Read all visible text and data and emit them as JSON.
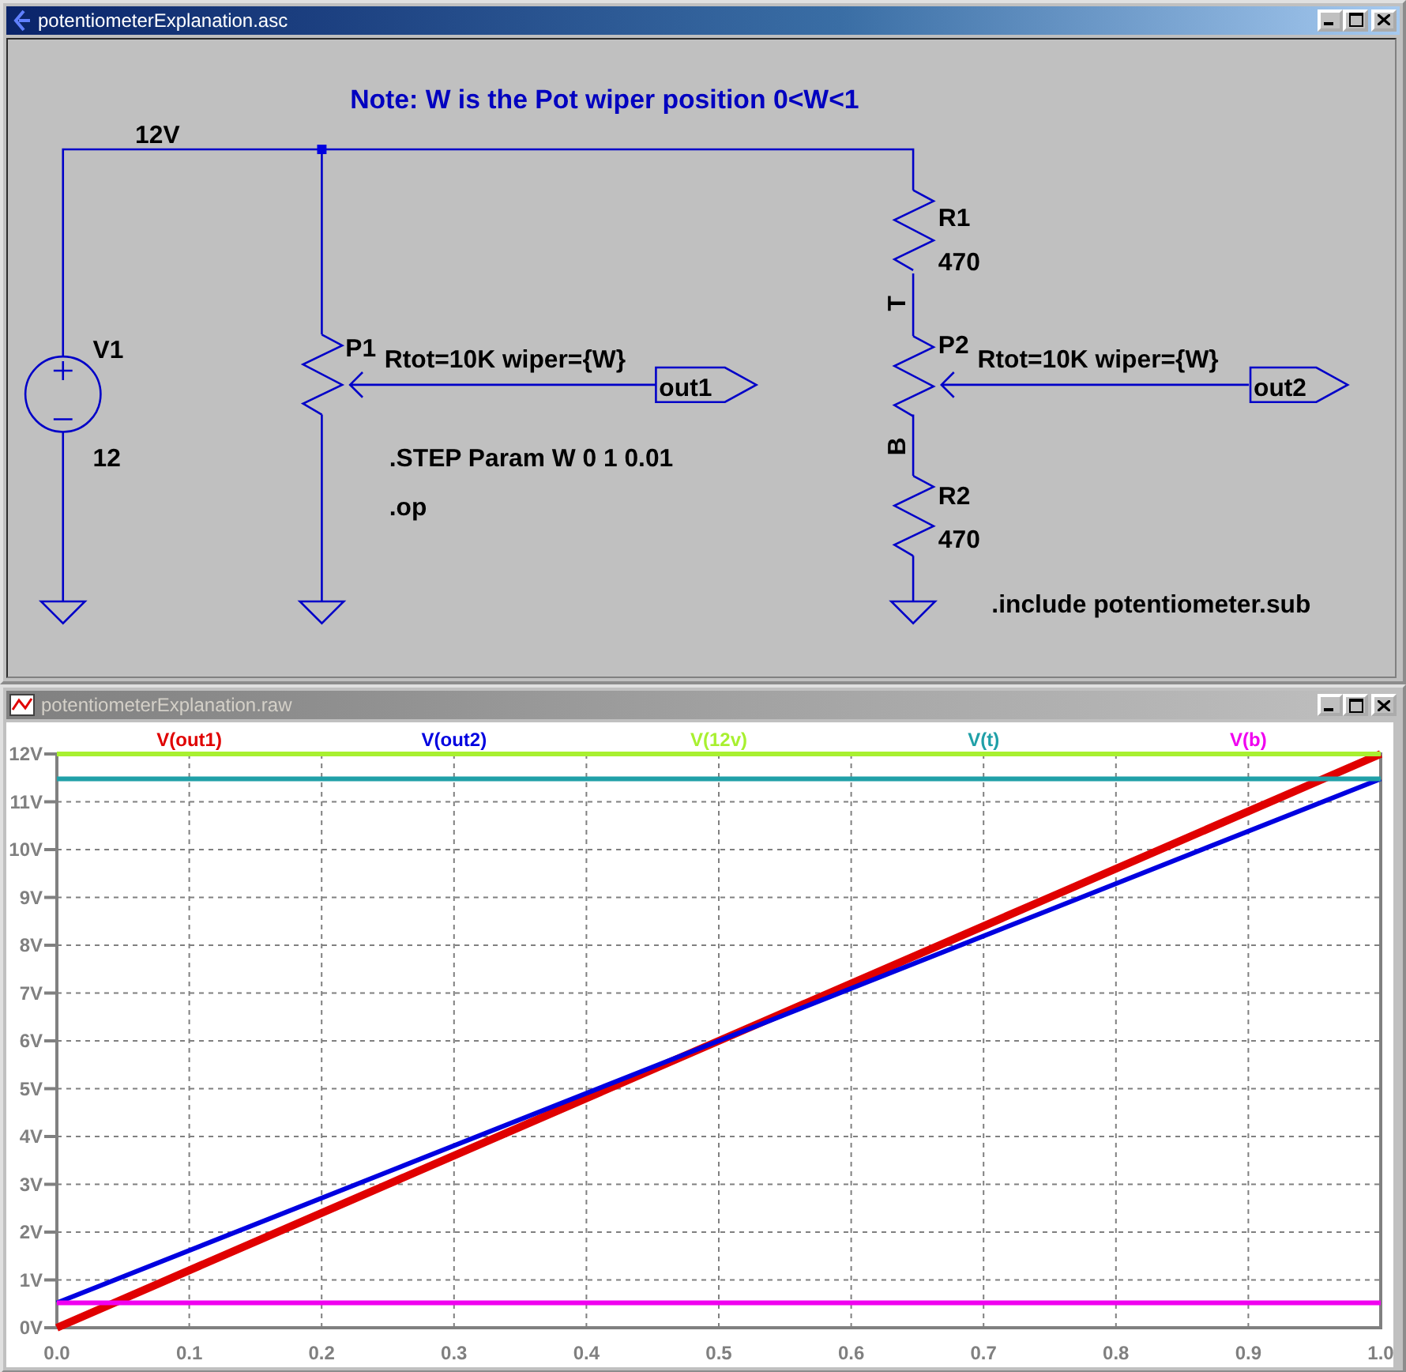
{
  "schematic_window": {
    "title": "potentiometerExplanation.asc",
    "note": "Note: W is the Pot wiper position 0<W<1",
    "net_label": "12V",
    "v1": {
      "name": "V1",
      "value": "12"
    },
    "p1": {
      "name": "P1",
      "params": "Rtot=10K wiper={W}",
      "port": "out1"
    },
    "p2": {
      "name": "P2",
      "params": "Rtot=10K wiper={W}",
      "port": "out2"
    },
    "r1": {
      "name": "R1",
      "value": "470"
    },
    "r2": {
      "name": "R2",
      "value": "470"
    },
    "node_labels": [
      "T",
      "B"
    ],
    "directives": [
      ".STEP Param W 0 1 0.01",
      ".op",
      ".include potentiometer.sub"
    ]
  },
  "plot_window": {
    "title": "potentiometerExplanation.raw",
    "chart_data": {
      "type": "line",
      "x": [
        0,
        0.25,
        0.5,
        0.75,
        1
      ],
      "series": [
        {
          "name": "V(out1)",
          "color": "#e00000",
          "values": [
            0,
            3,
            6,
            9,
            12
          ]
        },
        {
          "name": "V(out2)",
          "color": "#0000e0",
          "values": [
            0.52,
            3.26,
            6,
            8.74,
            11.48
          ]
        },
        {
          "name": "V(12v)",
          "color": "#a8f030",
          "values": [
            12,
            12,
            12,
            12,
            12
          ]
        },
        {
          "name": "V(t)",
          "color": "#20a0a8",
          "values": [
            11.48,
            11.48,
            11.48,
            11.48,
            11.48
          ]
        },
        {
          "name": "V(b)",
          "color": "#f000f0",
          "values": [
            0.52,
            0.52,
            0.52,
            0.52,
            0.52
          ]
        }
      ],
      "xlim": [
        0,
        1
      ],
      "ylim": [
        0,
        12
      ],
      "grid": true,
      "xticks": [
        {
          "value": 0,
          "label": "0.0"
        },
        {
          "value": 0.1,
          "label": "0.1"
        },
        {
          "value": 0.2,
          "label": "0.2"
        },
        {
          "value": 0.3,
          "label": "0.3"
        },
        {
          "value": 0.4,
          "label": "0.4"
        },
        {
          "value": 0.5,
          "label": "0.5"
        },
        {
          "value": 0.6,
          "label": "0.6"
        },
        {
          "value": 0.7,
          "label": "0.7"
        },
        {
          "value": 0.8,
          "label": "0.8"
        },
        {
          "value": 0.9,
          "label": "0.9"
        },
        {
          "value": 1,
          "label": "1.0"
        }
      ],
      "yticks": [
        {
          "value": 0,
          "label": "0V"
        },
        {
          "value": 1,
          "label": "1V"
        },
        {
          "value": 2,
          "label": "2V"
        },
        {
          "value": 3,
          "label": "3V"
        },
        {
          "value": 4,
          "label": "4V"
        },
        {
          "value": 5,
          "label": "5V"
        },
        {
          "value": 6,
          "label": "6V"
        },
        {
          "value": 7,
          "label": "7V"
        },
        {
          "value": 8,
          "label": "8V"
        },
        {
          "value": 9,
          "label": "9V"
        },
        {
          "value": 10,
          "label": "10V"
        },
        {
          "value": 11,
          "label": "11V"
        },
        {
          "value": 12,
          "label": "12V"
        }
      ]
    }
  }
}
